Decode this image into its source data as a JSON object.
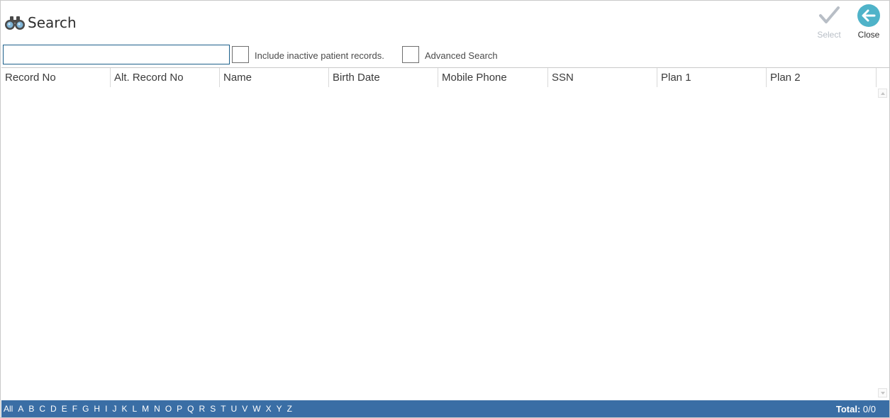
{
  "header": {
    "title": "Search",
    "title_icon": "binoculars-icon"
  },
  "toolbar": {
    "select_label": "Select",
    "close_label": "Close",
    "select_color": "#b8bec6",
    "close_color": "#4fb3c9"
  },
  "search": {
    "value": "",
    "placeholder": ""
  },
  "options": {
    "inactive_label": "Include inactive patient records.",
    "inactive_checked": false,
    "advanced_label": "Advanced Search",
    "advanced_checked": false
  },
  "columns": [
    "Record No",
    "Alt. Record No",
    "Name",
    "Birth Date",
    "Mobile Phone",
    "SSN",
    "Plan 1",
    "Plan 2"
  ],
  "rows": [],
  "footer": {
    "letters": [
      "All",
      "A",
      "B",
      "C",
      "D",
      "E",
      "F",
      "G",
      "H",
      "I",
      "J",
      "K",
      "L",
      "M",
      "N",
      "O",
      "P",
      "Q",
      "R",
      "S",
      "T",
      "U",
      "V",
      "W",
      "X",
      "Y",
      "Z"
    ],
    "total_label": "Total:",
    "total_value": "0/0",
    "bar_color": "#3a6ea5"
  }
}
